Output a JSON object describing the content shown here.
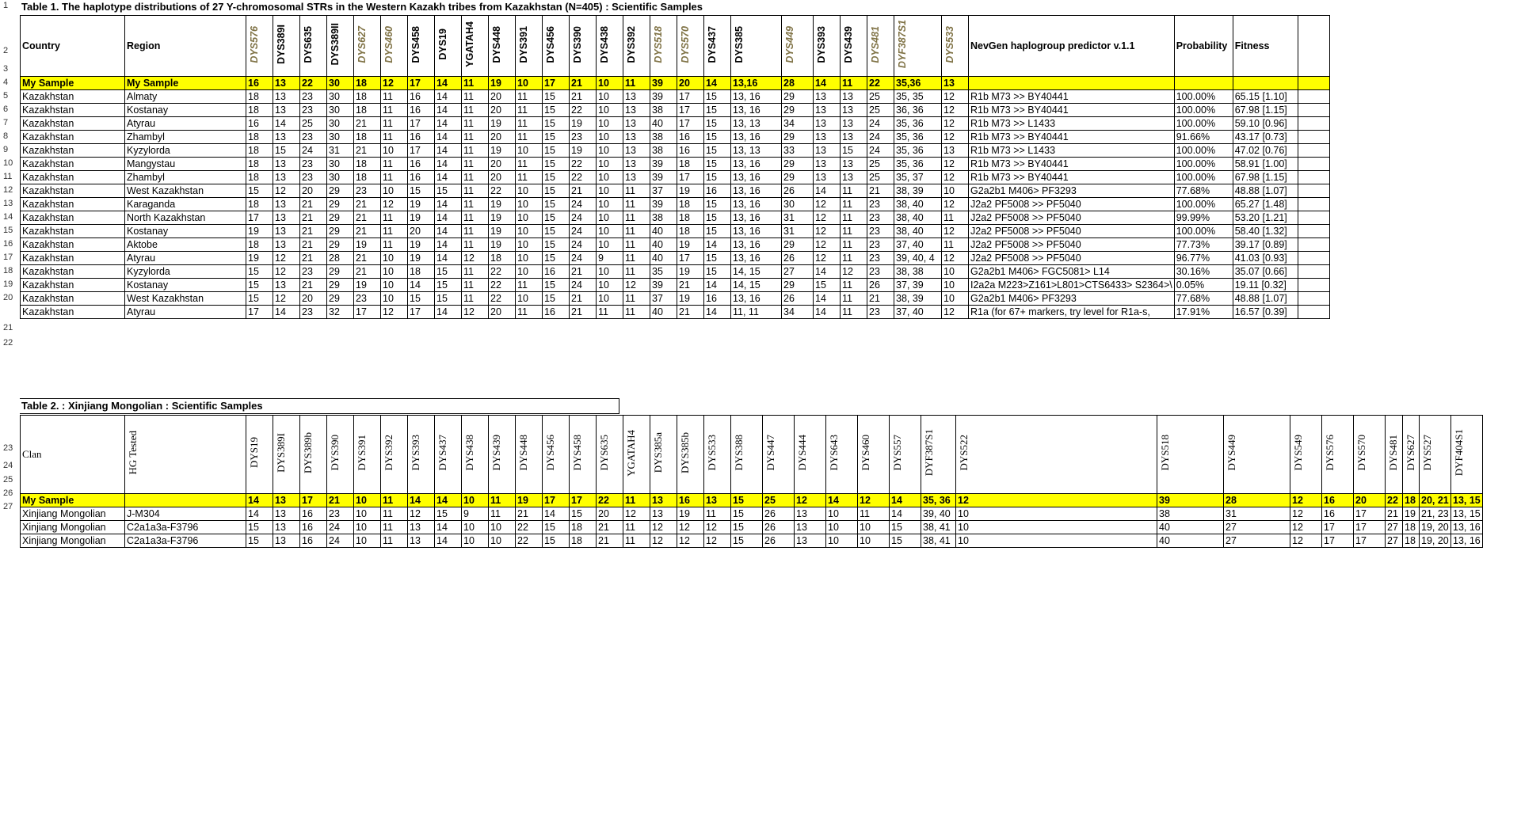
{
  "table1": {
    "title": "Table 1. The haplotype distributions of 27 Y-chromosomal STRs in the Western Kazakh tribes from Kazakhstan (N=405) : Scientific Samples",
    "headers": [
      {
        "label": "Country",
        "vertical": false,
        "olive": false
      },
      {
        "label": "Region",
        "vertical": false,
        "olive": false
      },
      {
        "label": "DYS576",
        "vertical": true,
        "olive": true
      },
      {
        "label": "DYS389I",
        "vertical": true,
        "olive": false
      },
      {
        "label": "DYS635",
        "vertical": true,
        "olive": false
      },
      {
        "label": "DYS389II",
        "vertical": true,
        "olive": false
      },
      {
        "label": "DYS627",
        "vertical": true,
        "olive": true
      },
      {
        "label": "DYS460",
        "vertical": true,
        "olive": true
      },
      {
        "label": "DYS458",
        "vertical": true,
        "olive": false
      },
      {
        "label": "DYS19",
        "vertical": true,
        "olive": false
      },
      {
        "label": "YGATAH4",
        "vertical": true,
        "olive": false
      },
      {
        "label": "DYS448",
        "vertical": true,
        "olive": false
      },
      {
        "label": "DYS391",
        "vertical": true,
        "olive": false
      },
      {
        "label": "DYS456",
        "vertical": true,
        "olive": false
      },
      {
        "label": "DYS390",
        "vertical": true,
        "olive": false
      },
      {
        "label": "DYS438",
        "vertical": true,
        "olive": false
      },
      {
        "label": "DYS392",
        "vertical": true,
        "olive": false
      },
      {
        "label": "DYS518",
        "vertical": true,
        "olive": true
      },
      {
        "label": "DYS570",
        "vertical": true,
        "olive": true
      },
      {
        "label": "DYS437",
        "vertical": true,
        "olive": false
      },
      {
        "label": "DYS385",
        "vertical": true,
        "olive": false
      },
      {
        "label": "DYS449",
        "vertical": true,
        "olive": true
      },
      {
        "label": "DYS393",
        "vertical": true,
        "olive": false
      },
      {
        "label": "DYS439",
        "vertical": true,
        "olive": false
      },
      {
        "label": "DYS481",
        "vertical": true,
        "olive": true
      },
      {
        "label": "DYF387S1",
        "vertical": true,
        "olive": true
      },
      {
        "label": "DYS533",
        "vertical": true,
        "olive": true
      },
      {
        "label": "NevGen haplogroup predictor v.1.1",
        "vertical": false,
        "olive": false
      },
      {
        "label": "Probability",
        "vertical": false,
        "olive": false
      },
      {
        "label": "Fitness",
        "vertical": false,
        "olive": false
      },
      {
        "label": "",
        "vertical": false,
        "olive": false
      }
    ],
    "my_sample": [
      "My Sample",
      "My Sample",
      "16",
      "13",
      "22",
      "30",
      "18",
      "12",
      "17",
      "14",
      "11",
      "19",
      "10",
      "17",
      "21",
      "10",
      "11",
      "39",
      "20",
      "14",
      "13,16",
      "28",
      "14",
      "11",
      "22",
      "35,36",
      "13",
      "",
      "",
      "",
      ""
    ],
    "rows": [
      [
        "Kazakhstan",
        "Almaty",
        "18",
        "13",
        "23",
        "30",
        "18",
        "11",
        "16",
        "14",
        "11",
        "20",
        "11",
        "15",
        "21",
        "10",
        "13",
        "39",
        "17",
        "15",
        "13, 16",
        "29",
        "13",
        "13",
        "25",
        "35, 35",
        "12",
        "R1b M73 >> BY40441",
        "100.00%",
        "65.15 [1.10]",
        ""
      ],
      [
        "Kazakhstan",
        "Kostanay",
        "18",
        "13",
        "23",
        "30",
        "18",
        "11",
        "16",
        "14",
        "11",
        "20",
        "11",
        "15",
        "22",
        "10",
        "13",
        "38",
        "17",
        "15",
        "13, 16",
        "29",
        "13",
        "13",
        "25",
        "36, 36",
        "12",
        "R1b M73 >> BY40441",
        "100.00%",
        "67.98 [1.15]",
        ""
      ],
      [
        "Kazakhstan",
        "Atyrau",
        "16",
        "14",
        "25",
        "30",
        "21",
        "11",
        "17",
        "14",
        "11",
        "19",
        "11",
        "15",
        "19",
        "10",
        "13",
        "40",
        "17",
        "15",
        "13, 13",
        "34",
        "13",
        "13",
        "24",
        "35, 36",
        "12",
        "R1b M73 >> L1433",
        "100.00%",
        "59.10 [0.96]",
        ""
      ],
      [
        "Kazakhstan",
        "Zhambyl",
        "18",
        "13",
        "23",
        "30",
        "18",
        "11",
        "16",
        "14",
        "11",
        "20",
        "11",
        "15",
        "23",
        "10",
        "13",
        "38",
        "16",
        "15",
        "13, 16",
        "29",
        "13",
        "13",
        "24",
        "35, 36",
        "12",
        "R1b M73 >> BY40441",
        "91.66%",
        "43.17 [0.73]",
        ""
      ],
      [
        "Kazakhstan",
        "Kyzylorda",
        "18",
        "15",
        "24",
        "31",
        "21",
        "10",
        "17",
        "14",
        "11",
        "19",
        "10",
        "15",
        "19",
        "10",
        "13",
        "38",
        "16",
        "15",
        "13, 13",
        "33",
        "13",
        "15",
        "24",
        "35, 36",
        "13",
        "R1b M73 >> L1433",
        "100.00%",
        "47.02 [0.76]",
        ""
      ],
      [
        "Kazakhstan",
        "Mangystau",
        "18",
        "13",
        "23",
        "30",
        "18",
        "11",
        "16",
        "14",
        "11",
        "20",
        "11",
        "15",
        "22",
        "10",
        "13",
        "39",
        "18",
        "15",
        "13, 16",
        "29",
        "13",
        "13",
        "25",
        "35, 36",
        "12",
        "R1b M73 >> BY40441",
        "100.00%",
        "58.91 [1.00]",
        ""
      ],
      [
        "Kazakhstan",
        "Zhambyl",
        "18",
        "13",
        "23",
        "30",
        "18",
        "11",
        "16",
        "14",
        "11",
        "20",
        "11",
        "15",
        "22",
        "10",
        "13",
        "39",
        "17",
        "15",
        "13, 16",
        "29",
        "13",
        "13",
        "25",
        "35, 37",
        "12",
        "R1b M73 >> BY40441",
        "100.00%",
        "67.98 [1.15]",
        ""
      ],
      [
        "Kazakhstan",
        "West Kazakhstan",
        "15",
        "12",
        "20",
        "29",
        "23",
        "10",
        "15",
        "15",
        "11",
        "22",
        "10",
        "15",
        "21",
        "10",
        "11",
        "37",
        "19",
        "16",
        "13, 16",
        "26",
        "14",
        "11",
        "21",
        "38, 39",
        "10",
        "G2a2b1 M406> PF3293",
        "77.68%",
        "48.88 [1.07]",
        ""
      ],
      [
        "Kazakhstan",
        "Karaganda",
        "18",
        "13",
        "21",
        "29",
        "21",
        "12",
        "19",
        "14",
        "11",
        "19",
        "10",
        "15",
        "24",
        "10",
        "11",
        "39",
        "18",
        "15",
        "13, 16",
        "30",
        "12",
        "11",
        "23",
        "38, 40",
        "12",
        "J2a2 PF5008 >> PF5040",
        "100.00%",
        "65.27 [1.48]",
        ""
      ],
      [
        "Kazakhstan",
        "North Kazakhstan",
        "17",
        "13",
        "21",
        "29",
        "21",
        "11",
        "19",
        "14",
        "11",
        "19",
        "10",
        "15",
        "24",
        "10",
        "11",
        "38",
        "18",
        "15",
        "13, 16",
        "31",
        "12",
        "11",
        "23",
        "38, 40",
        "11",
        "J2a2 PF5008 >> PF5040",
        "99.99%",
        "53.20 [1.21]",
        ""
      ],
      [
        "Kazakhstan",
        "Kostanay",
        "19",
        "13",
        "21",
        "29",
        "21",
        "11",
        "20",
        "14",
        "11",
        "19",
        "10",
        "15",
        "24",
        "10",
        "11",
        "40",
        "18",
        "15",
        "13, 16",
        "31",
        "12",
        "11",
        "23",
        "38, 40",
        "12",
        "J2a2 PF5008 >> PF5040",
        "100.00%",
        "58.40 [1.32]",
        ""
      ],
      [
        "Kazakhstan",
        "Aktobe",
        "18",
        "13",
        "21",
        "29",
        "19",
        "11",
        "19",
        "14",
        "11",
        "19",
        "10",
        "15",
        "24",
        "10",
        "11",
        "40",
        "19",
        "14",
        "13, 16",
        "29",
        "12",
        "11",
        "23",
        "37, 40",
        "11",
        "J2a2 PF5008 >> PF5040",
        "77.73%",
        "39.17 [0.89]",
        ""
      ],
      [
        "Kazakhstan",
        "Atyrau",
        "19",
        "12",
        "21",
        "28",
        "21",
        "10",
        "19",
        "14",
        "12",
        "18",
        "10",
        "15",
        "24",
        "9",
        "11",
        "40",
        "17",
        "15",
        "13, 16",
        "26",
        "12",
        "11",
        "23",
        "39, 40, 4",
        "12",
        "J2a2 PF5008 >> PF5040",
        "96.77%",
        "41.03 [0.93]",
        ""
      ],
      [
        "Kazakhstan",
        "Kyzylorda",
        "15",
        "12",
        "23",
        "29",
        "21",
        "10",
        "18",
        "15",
        "11",
        "22",
        "10",
        "16",
        "21",
        "10",
        "11",
        "35",
        "19",
        "15",
        "14, 15",
        "27",
        "14",
        "12",
        "23",
        "38, 38",
        "10",
        "G2a2b1 M406> FGC5081> L14",
        "30.16%",
        "35.07 [0.66]",
        ""
      ],
      [
        "Kazakhstan",
        "Kostanay",
        "15",
        "13",
        "21",
        "29",
        "19",
        "10",
        "14",
        "15",
        "11",
        "22",
        "11",
        "15",
        "24",
        "10",
        "12",
        "39",
        "21",
        "14",
        "14, 15",
        "29",
        "15",
        "11",
        "26",
        "37, 39",
        "10",
        "I2a2a M223>Z161>L801>CTS6433> S2364>\\",
        "0.05%",
        "19.11 [0.32]",
        ""
      ],
      [
        "Kazakhstan",
        "West Kazakhstan",
        "15",
        "12",
        "20",
        "29",
        "23",
        "10",
        "15",
        "15",
        "11",
        "22",
        "10",
        "15",
        "21",
        "10",
        "11",
        "37",
        "19",
        "16",
        "13, 16",
        "26",
        "14",
        "11",
        "21",
        "38, 39",
        "10",
        "G2a2b1 M406> PF3293",
        "77.68%",
        "48.88 [1.07]",
        ""
      ],
      [
        "Kazakhstan",
        "Atyrau",
        "17",
        "14",
        "23",
        "32",
        "17",
        "12",
        "17",
        "14",
        "12",
        "20",
        "11",
        "16",
        "21",
        "11",
        "11",
        "40",
        "21",
        "14",
        "11, 11",
        "34",
        "14",
        "11",
        "23",
        "37, 40",
        "12",
        "R1a (for 67+ markers, try level for R1a-s,",
        "17.91%",
        "16.57 [0.39]",
        ""
      ]
    ]
  },
  "table2": {
    "title": "Table 2. : Xinjiang Mongolian :  Scientific Samples",
    "headers": [
      "Clan",
      "HG Tested",
      "DYS19",
      "DYS389I",
      "DYS389b",
      "DYS390",
      "DYS391",
      "DYS392",
      "DYS393",
      "DYS437",
      "DYS438",
      "DYS439",
      "DYS448",
      "DYS456",
      "DYS458",
      "DYS635",
      "YGATAH4",
      "DYS385a",
      "DYS385b",
      "DYS533",
      "DYS388",
      "DYS447",
      "DYS444",
      "DYS643",
      "DYS460",
      "DYS557",
      "DYF387S1",
      "DYS522",
      "DYS518",
      "DYS449",
      "DYS549",
      "DYS576",
      "DYS570",
      "DYS481",
      "DYS627",
      "DYS527",
      "DYF404S1"
    ],
    "my_sample": [
      "My Sample",
      "",
      "14",
      "13",
      "17",
      "21",
      "10",
      "11",
      "14",
      "14",
      "10",
      "11",
      "19",
      "17",
      "17",
      "22",
      "11",
      "13",
      "16",
      "13",
      "15",
      "25",
      "12",
      "14",
      "12",
      "14",
      "35, 36",
      "12",
      "39",
      "28",
      "12",
      "16",
      "20",
      "22",
      "18",
      "20, 21",
      "13, 15"
    ],
    "rows": [
      [
        "Xinjiang Mongolian",
        "J-M304",
        "14",
        "13",
        "16",
        "23",
        "10",
        "11",
        "12",
        "15",
        "9",
        "11",
        "21",
        "14",
        "15",
        "20",
        "12",
        "13",
        "19",
        "11",
        "15",
        "26",
        "13",
        "10",
        "11",
        "14",
        "39, 40",
        "10",
        "38",
        "31",
        "12",
        "16",
        "17",
        "21",
        "19",
        "21, 23",
        "13, 15"
      ],
      [
        "Xinjiang Mongolian",
        "C2a1a3a-F3796",
        "15",
        "13",
        "16",
        "24",
        "10",
        "11",
        "13",
        "14",
        "10",
        "10",
        "22",
        "15",
        "18",
        "21",
        "11",
        "12",
        "12",
        "12",
        "15",
        "26",
        "13",
        "10",
        "10",
        "15",
        "38, 41",
        "10",
        "40",
        "27",
        "12",
        "17",
        "17",
        "27",
        "18",
        "19, 20",
        "13, 16"
      ],
      [
        "Xinjiang Mongolian",
        "C2a1a3a-F3796",
        "15",
        "13",
        "16",
        "24",
        "10",
        "11",
        "13",
        "14",
        "10",
        "10",
        "22",
        "15",
        "18",
        "21",
        "11",
        "12",
        "12",
        "12",
        "15",
        "26",
        "13",
        "10",
        "10",
        "15",
        "38, 41",
        "10",
        "40",
        "27",
        "12",
        "17",
        "17",
        "27",
        "18",
        "19, 20",
        "13, 16"
      ]
    ]
  },
  "row_numbers": [
    "1",
    "2",
    "3",
    "4",
    "5",
    "6",
    "7",
    "8",
    "9",
    "10",
    "11",
    "12",
    "13",
    "14",
    "15",
    "16",
    "17",
    "18",
    "19",
    "20",
    "21",
    "22",
    "23",
    "24",
    "25",
    "26",
    "27"
  ]
}
